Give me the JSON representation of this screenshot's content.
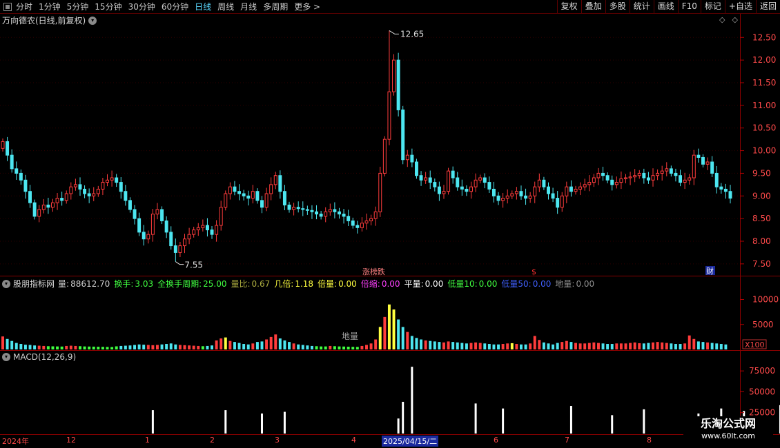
{
  "toolbar": {
    "timeframes": [
      {
        "label": "分时"
      },
      {
        "label": "1分钟"
      },
      {
        "label": "5分钟"
      },
      {
        "label": "15分钟"
      },
      {
        "label": "30分钟"
      },
      {
        "label": "60分钟"
      },
      {
        "label": "日线"
      },
      {
        "label": "周线"
      },
      {
        "label": "月线"
      },
      {
        "label": "多周期"
      },
      {
        "label": "更多 >"
      }
    ],
    "active_timeframe": "日线",
    "right_buttons": [
      {
        "label": "复权"
      },
      {
        "label": "叠加"
      },
      {
        "label": "多股"
      },
      {
        "label": "统计"
      },
      {
        "label": "画线"
      },
      {
        "label": "F10"
      },
      {
        "label": "标记"
      },
      {
        "label": "+自选"
      },
      {
        "label": "返回"
      }
    ]
  },
  "chart_title": "万向德农(日线,前复权)",
  "right_symbols": [
    "◇",
    "◇"
  ],
  "annotations": {
    "high": "12.65",
    "low": "7.55",
    "tag1": "涨榜跌",
    "tag2": "$",
    "tag3": "财"
  },
  "volume_panel": {
    "name": "股朋指标网",
    "metrics": [
      {
        "label": "量:",
        "value": "88612.70",
        "color": "#d0d0d0"
      },
      {
        "label": "换手:",
        "value": "3.03",
        "color": "#40ff40"
      },
      {
        "label": "全换手周期:",
        "value": "25.00",
        "color": "#40ff40"
      },
      {
        "label": "量比:",
        "value": "0.67",
        "color": "#b0b040"
      },
      {
        "label": "几倍:",
        "value": "1.18",
        "color": "#ffff40"
      },
      {
        "label": "倍量:",
        "value": "0.00",
        "color": "#ffff40"
      },
      {
        "label": "倍缩:",
        "value": "0.00",
        "color": "#ff40ff"
      },
      {
        "label": "平量:",
        "value": "0.00",
        "color": "#ffffff"
      },
      {
        "label": "低量10:",
        "value": "0.00",
        "color": "#40ff40"
      },
      {
        "label": "低量50:",
        "value": "0.00",
        "color": "#4060ff"
      },
      {
        "label": "地量:",
        "value": "0.00",
        "color": "#909090"
      }
    ],
    "label_in_chart": "地量",
    "unit": "X100",
    "axis_ticks": [
      "10000",
      "5000"
    ]
  },
  "macd_panel": {
    "label": "MACD(12,26,9)",
    "axis_ticks": [
      "75000",
      "50000",
      "25000"
    ]
  },
  "date_axis": {
    "labels": [
      "2024年",
      "12",
      "1",
      "2",
      "3",
      "4",
      "6",
      "7",
      "8"
    ],
    "highlight": "2025/04/15/二"
  },
  "watermark": {
    "line1": "乐淘公式网",
    "line2": "www.60lt.com"
  },
  "chart_data": [
    {
      "type": "candlestick",
      "ylim": [
        7.3,
        12.9
      ],
      "yticks": [
        12.5,
        12.0,
        11.5,
        11.0,
        10.5,
        10.0,
        9.5,
        9.0,
        8.5,
        8.0,
        7.5
      ],
      "colors": {
        "up": "#ff3c3c",
        "down": "#4de6f0"
      },
      "closes": [
        10.2,
        9.9,
        9.6,
        9.5,
        9.35,
        9.1,
        8.85,
        8.55,
        8.7,
        8.8,
        8.75,
        8.85,
        8.95,
        8.9,
        9.05,
        9.2,
        9.25,
        9.15,
        9.05,
        9.0,
        9.05,
        9.15,
        9.3,
        9.35,
        9.4,
        9.3,
        9.1,
        8.9,
        8.7,
        8.5,
        8.2,
        8.05,
        8.15,
        8.6,
        8.7,
        8.45,
        8.2,
        7.9,
        7.75,
        7.9,
        8.05,
        8.15,
        8.25,
        8.3,
        8.35,
        8.25,
        8.15,
        8.35,
        8.75,
        9.05,
        9.2,
        9.1,
        9.05,
        9.0,
        8.95,
        9.1,
        8.9,
        8.75,
        9.05,
        9.25,
        9.45,
        9.1,
        8.8,
        8.7,
        8.75,
        8.72,
        8.7,
        8.68,
        8.65,
        8.6,
        8.55,
        8.65,
        8.7,
        8.65,
        8.6,
        8.55,
        8.45,
        8.35,
        8.3,
        8.4,
        8.45,
        8.5,
        8.65,
        9.5,
        10.25,
        11.3,
        12.0,
        10.9,
        9.8,
        9.9,
        9.75,
        9.45,
        9.35,
        9.4,
        9.3,
        9.2,
        9.05,
        9.1,
        9.55,
        9.4,
        9.2,
        9.15,
        9.1,
        9.2,
        9.35,
        9.4,
        9.3,
        9.15,
        9.0,
        8.9,
        8.95,
        9.0,
        9.05,
        9.1,
        9.0,
        8.95,
        9.0,
        9.2,
        9.35,
        9.2,
        9.05,
        8.95,
        8.75,
        9.0,
        9.2,
        9.1,
        9.15,
        9.2,
        9.25,
        9.3,
        9.4,
        9.5,
        9.45,
        9.35,
        9.25,
        9.3,
        9.38,
        9.4,
        9.42,
        9.45,
        9.5,
        9.4,
        9.35,
        9.45,
        9.5,
        9.55,
        9.6,
        9.5,
        9.45,
        9.3,
        9.35,
        9.4,
        9.9,
        9.85,
        9.7,
        9.75,
        9.5,
        9.2,
        9.15,
        9.1,
        8.95
      ],
      "highs": {
        "85": 12.65
      },
      "lows": {
        "38": 7.55
      }
    },
    {
      "type": "bar",
      "name": "volume",
      "ylim": [
        0,
        12000
      ],
      "colors": {
        "up": "#ff3c3c",
        "down": "#4de6f0",
        "low": "#40ff40",
        "spike": "#ffff40"
      },
      "values": [
        2600,
        2100,
        1700,
        1300,
        1100,
        950,
        900,
        800,
        750,
        700,
        650,
        620,
        600,
        580,
        700,
        750,
        700,
        650,
        600,
        580,
        560,
        540,
        520,
        500,
        480,
        620,
        700,
        750,
        800,
        900,
        1000,
        950,
        900,
        850,
        900,
        1000,
        1100,
        1200,
        1000,
        900,
        850,
        800,
        750,
        700,
        650,
        700,
        800,
        1800,
        2200,
        2400,
        1700,
        1500,
        1300,
        1100,
        1000,
        1200,
        1500,
        1600,
        2000,
        2500,
        3000,
        2200,
        1800,
        1500,
        1200,
        1000,
        900,
        800,
        700,
        650,
        600,
        600,
        700,
        650,
        600,
        580,
        550,
        520,
        500,
        700,
        900,
        1200,
        2000,
        4500,
        6500,
        9000,
        8000,
        6000,
        4500,
        3500,
        2700,
        2300,
        2000,
        1800,
        1700,
        1600,
        1500,
        1400,
        1600,
        1500,
        1400,
        1300,
        1200,
        1300,
        1400,
        1300,
        1200,
        1100,
        1000,
        1000,
        1100,
        1200,
        1250,
        1100,
        1000,
        1000,
        1200,
        2700,
        1900,
        1400,
        1200,
        1000,
        1300,
        1500,
        1700,
        1500,
        1300,
        1200,
        1200,
        1300,
        1400,
        1300,
        1200,
        1100,
        1100,
        1200,
        1200,
        1200,
        1300,
        1400,
        1250,
        1200,
        1300,
        1400,
        1500,
        1400,
        1300,
        1200,
        1100,
        1100,
        1200,
        2800,
        2100,
        1600,
        1500,
        1400,
        1300,
        1200,
        1100,
        1000
      ],
      "spike_indices": [
        49,
        83,
        85,
        86,
        112
      ]
    },
    {
      "type": "bar",
      "name": "MACD",
      "ylim": [
        0,
        90000
      ],
      "colors": {
        "bar": "#ffffff"
      },
      "points": [
        [
          33,
          28000
        ],
        [
          49,
          28000
        ],
        [
          57,
          24000
        ],
        [
          62,
          26000
        ],
        [
          87,
          18000
        ],
        [
          88,
          38000
        ],
        [
          90,
          80000
        ],
        [
          104,
          36000
        ],
        [
          110,
          30000
        ],
        [
          125,
          33000
        ],
        [
          134,
          22000
        ],
        [
          141,
          29000
        ],
        [
          153,
          24000
        ],
        [
          158,
          30000
        ],
        [
          163,
          27000
        ],
        [
          171,
          34000
        ]
      ]
    }
  ]
}
